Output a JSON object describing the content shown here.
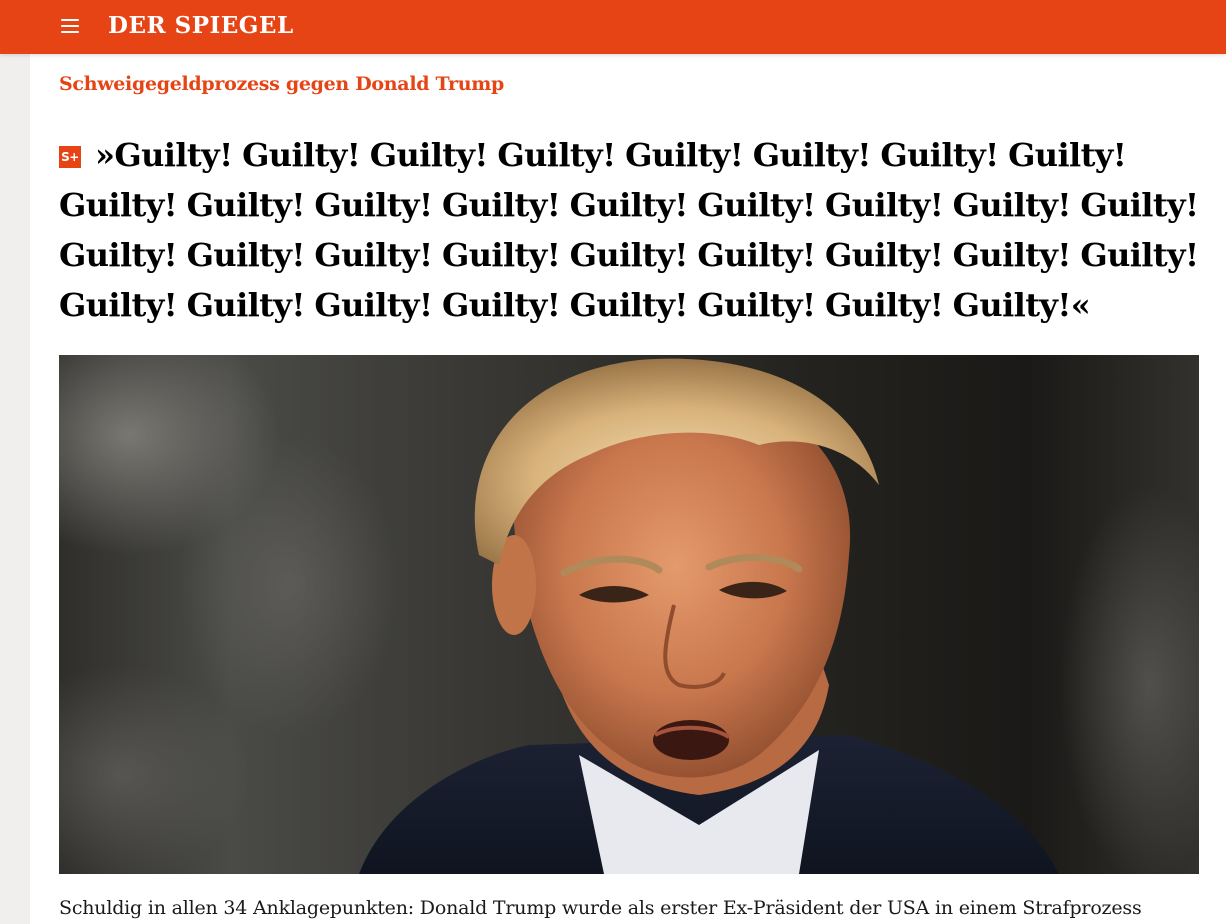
{
  "header": {
    "logo": "DER SPIEGEL",
    "menu_icon": "hamburger-menu-icon",
    "bar_color": "#e64415"
  },
  "article": {
    "kicker": "Schweigegeldprozess gegen Donald Trump",
    "badge": "S+",
    "headline": "»Guilty! Guilty! Guilty! Guilty! Guilty! Guilty! Guilty! Guilty! Guilty! Guilty! Guilty! Guilty! Guilty! Guilty! Guilty! Guilty! Guilty! Guilty! Guilty! Guilty! Guilty! Guilty! Guilty! Guilty! Guilty! Guilty! Guilty! Guilty! Guilty! Guilty! Guilty! Guilty! Guilty! Guilty!«",
    "caption": "Schuldig in allen 34 Anklagepunkten: Donald Trump wurde als erster Ex-Präsident der USA in einem Strafprozess"
  }
}
